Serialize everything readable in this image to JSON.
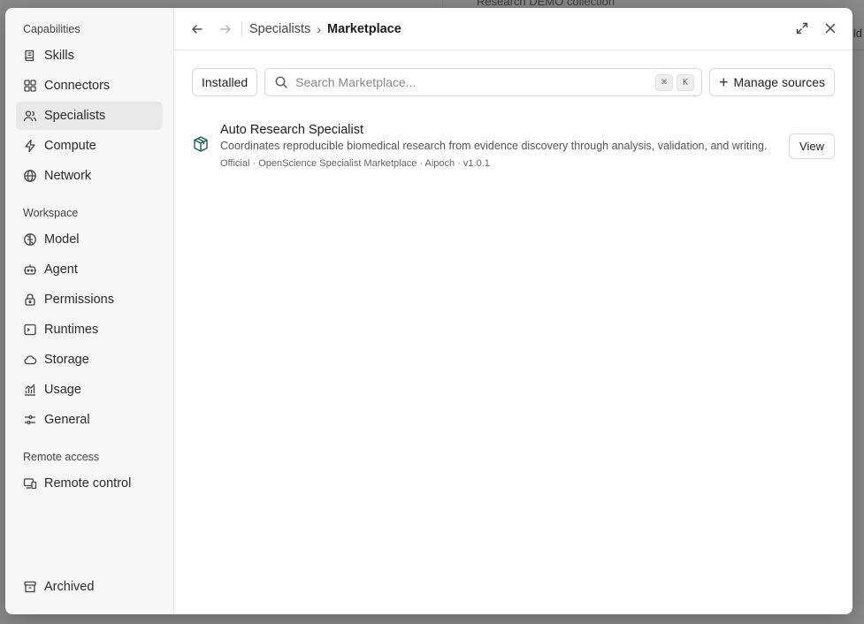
{
  "background": {
    "peek_text": "Research DEMO collection",
    "peek_right": "ld"
  },
  "sidebar": {
    "capabilities_label": "Capabilities",
    "capabilities": [
      {
        "label": "Skills",
        "icon": "book-icon"
      },
      {
        "label": "Connectors",
        "icon": "grid-icon"
      },
      {
        "label": "Specialists",
        "icon": "users-icon",
        "active": true
      },
      {
        "label": "Compute",
        "icon": "bolt-icon"
      },
      {
        "label": "Network",
        "icon": "globe-icon"
      }
    ],
    "workspace_label": "Workspace",
    "workspace": [
      {
        "label": "Model",
        "icon": "brain-icon"
      },
      {
        "label": "Agent",
        "icon": "robot-icon"
      },
      {
        "label": "Permissions",
        "icon": "lock-icon"
      },
      {
        "label": "Runtimes",
        "icon": "terminal-icon"
      },
      {
        "label": "Storage",
        "icon": "cloud-icon"
      },
      {
        "label": "Usage",
        "icon": "chart-icon"
      },
      {
        "label": "General",
        "icon": "sliders-icon"
      }
    ],
    "remote_label": "Remote access",
    "remote": [
      {
        "label": "Remote control",
        "icon": "devices-icon"
      }
    ],
    "archived": {
      "label": "Archived",
      "icon": "archive-icon"
    }
  },
  "header": {
    "breadcrumb": [
      "Specialists",
      "Marketplace"
    ],
    "separator": "›"
  },
  "toolbar": {
    "installed_label": "Installed",
    "search_placeholder": "Search Marketplace...",
    "kbd": [
      "⌘",
      "K"
    ],
    "manage_sources_label": "Manage sources"
  },
  "items": [
    {
      "title": "Auto Research Specialist",
      "description": "Coordinates reproducible biomedical research from evidence discovery through analysis, validation, and writing.",
      "meta": "Official · OpenScience Specialist Marketplace · Aipoch · v1.0.1",
      "action_label": "View",
      "icon": "package-icon",
      "icon_color": "#1e5a57"
    }
  ]
}
